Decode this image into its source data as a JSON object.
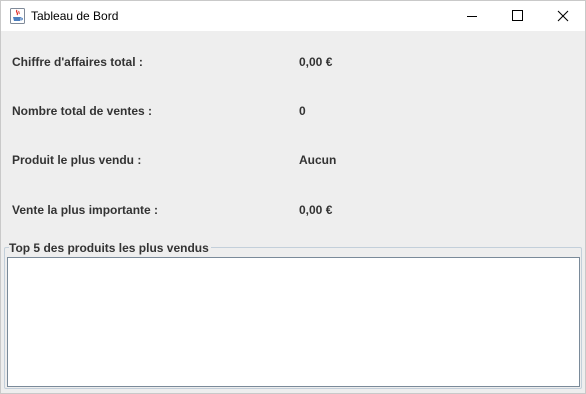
{
  "window": {
    "title": "Tableau de Bord",
    "app_icon": "java-coffee-icon",
    "controls": {
      "minimize_icon": "minimize-icon",
      "maximize_icon": "maximize-icon",
      "close_icon": "close-icon"
    }
  },
  "stats": [
    {
      "label": "Chiffre d'affaires total :",
      "value": "0,00 €"
    },
    {
      "label": "Nombre total de ventes :",
      "value": "0"
    },
    {
      "label": "Produit le plus vendu :",
      "value": "Aucun"
    },
    {
      "label": "Vente la plus importante :",
      "value": "0,00 €"
    }
  ],
  "top_products": {
    "title": "Top 5 des produits les plus vendus",
    "text": ""
  },
  "colors": {
    "background": "#eeeeee",
    "text": "#333333",
    "titlebar": "#ffffff",
    "group_border": "#c3cfda",
    "text_area_border": "#7a8a99"
  }
}
